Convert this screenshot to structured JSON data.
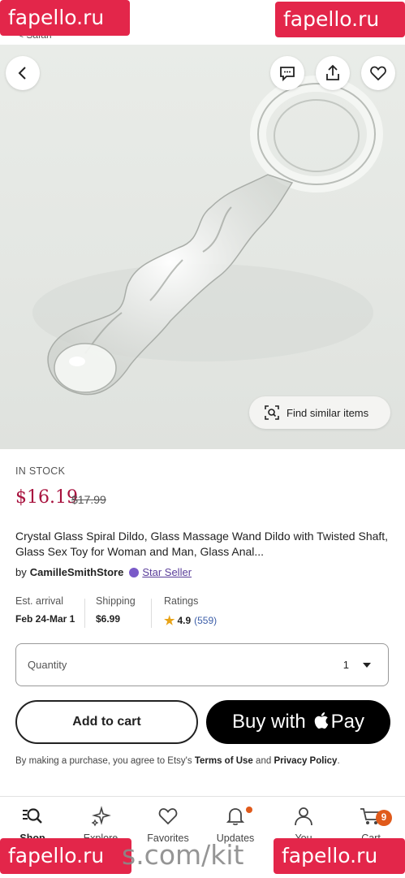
{
  "status_bar": {
    "back_label": "< Safari"
  },
  "watermarks": {
    "top_left": "fapello.ru",
    "top_right": "fapello.ru",
    "bottom_left": "fapello.ru",
    "bottom_right": "fapello.ru",
    "bottom_center": "s.com/kit"
  },
  "hero": {
    "find_similar_label": "Find similar items"
  },
  "product": {
    "stock": "IN STOCK",
    "price": "$16.19",
    "original_price": "$17.99",
    "title": "Crystal Glass Spiral Dildo, Glass Massage Wand Dildo with Twisted Shaft, Glass Sex Toy for Woman and Man, Glass Anal...",
    "by_prefix": "by",
    "shop_name": "CamilleSmithStore",
    "star_seller_label": "Star Seller"
  },
  "details": {
    "arrival_label": "Est. arrival",
    "arrival_value": "Feb 24-Mar 1",
    "shipping_label": "Shipping",
    "shipping_value": "$6.99",
    "ratings_label": "Ratings",
    "rating_value": "4.9",
    "rating_count": "(559)"
  },
  "quantity": {
    "label": "Quantity",
    "value": "1"
  },
  "actions": {
    "add_to_cart": "Add to cart",
    "buy_with": "Buy with",
    "pay": "Pay"
  },
  "terms": {
    "prefix": "By making a purchase, you agree to Etsy's",
    "terms_link": "Terms of Use",
    "and": "and",
    "privacy_link": "Privacy Policy",
    "suffix": "."
  },
  "nav": {
    "shop": "Shop",
    "explore": "Explore",
    "favorites": "Favorites",
    "updates": "Updates",
    "you": "You",
    "cart": "Cart",
    "cart_count": "9"
  },
  "colors": {
    "price": "#a8123e",
    "accent_orange": "#e05a1b",
    "star_seller_purple": "#5a3e9a",
    "watermark_red": "#e3264a"
  }
}
